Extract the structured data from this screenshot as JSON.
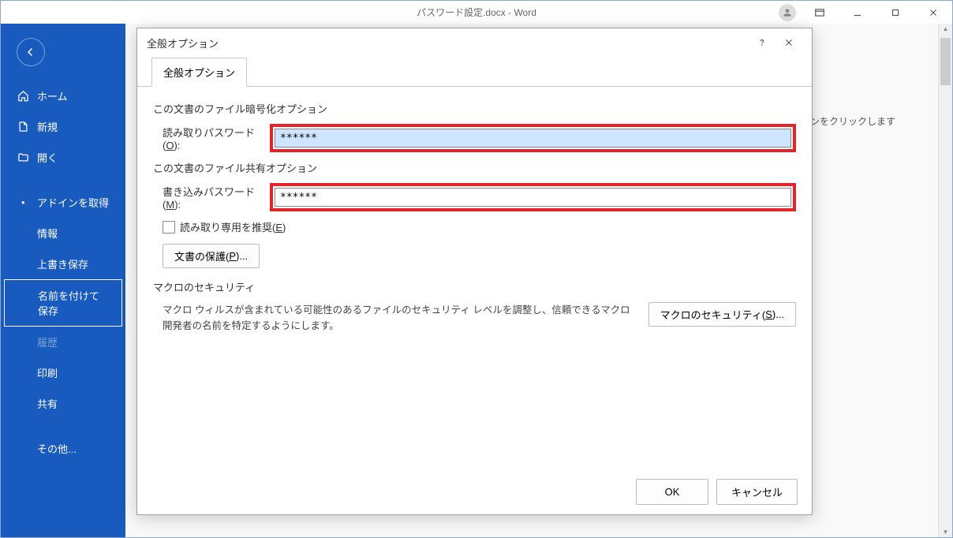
{
  "titlebar": {
    "document_title": "パスワード設定.docx - Word"
  },
  "sidebar": {
    "home": "ホーム",
    "new": "新規",
    "open": "開く",
    "addins": "アドインを取得",
    "info": "情報",
    "save": "上書き保存",
    "save_as": "名前を付けて保存",
    "history": "履歴",
    "print": "印刷",
    "share": "共有",
    "other": "その他..."
  },
  "content": {
    "icon_hint": "アイコンをクリックします"
  },
  "dialog": {
    "title": "全般オプション",
    "tab_label": "全般オプション",
    "encrypt_heading": "この文書のファイル暗号化オプション",
    "read_password_label_pre": "読み取りパスワード(",
    "read_password_label_key": "O",
    "read_password_label_post": "):",
    "read_password_value": "******",
    "share_heading": "この文書のファイル共有オプション",
    "write_password_label_pre": "書き込みパスワード(",
    "write_password_label_key": "M",
    "write_password_label_post": "):",
    "write_password_value": "******",
    "readonly_recommended_pre": "読み取り専用を推奨(",
    "readonly_recommended_key": "E",
    "readonly_recommended_post": ")",
    "protect_document_pre": "文書の保護(",
    "protect_document_key": "P",
    "protect_document_post": ")...",
    "macro_heading": "マクロのセキュリティ",
    "macro_text": "マクロ ウィルスが含まれている可能性のあるファイルのセキュリティ レベルを調整し、信頼できるマクロ開発者の名前を特定するようにします。",
    "macro_button_pre": "マクロのセキュリティ(",
    "macro_button_key": "S",
    "macro_button_post": ")...",
    "ok": "OK",
    "cancel": "キャンセル"
  }
}
